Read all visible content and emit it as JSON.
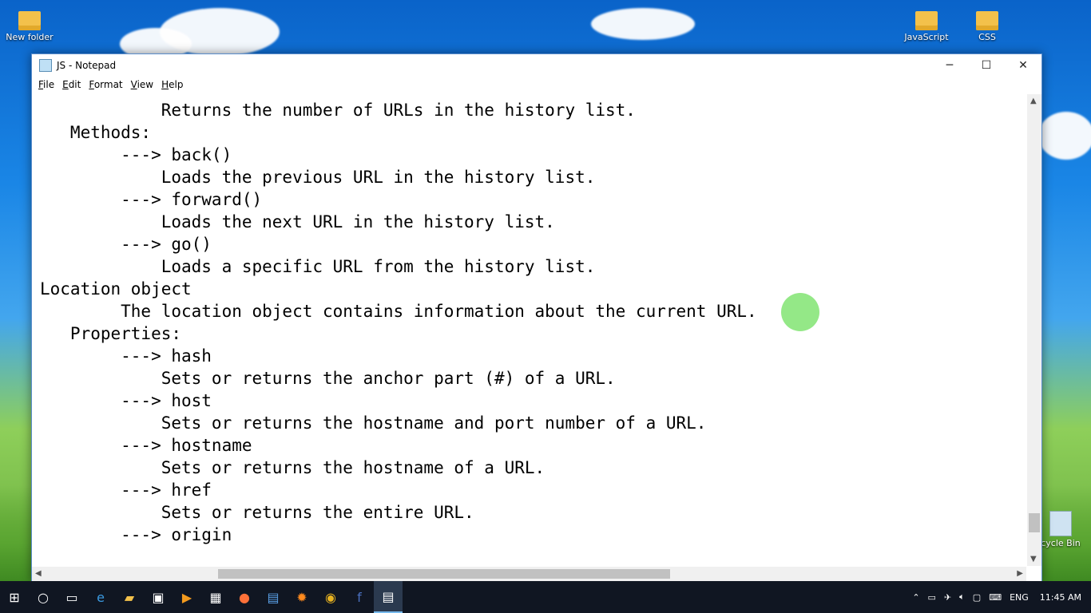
{
  "desktop": {
    "icons": [
      {
        "label": "New folder"
      },
      {
        "label": "JavaScript"
      },
      {
        "label": "CSS"
      },
      {
        "label": "cycle Bin"
      }
    ]
  },
  "window": {
    "title": "JS - Notepad",
    "controls": {
      "minimize": "─",
      "maximize": "☐",
      "close": "✕"
    },
    "menu": {
      "file": {
        "accel": "F",
        "rest": "ile"
      },
      "edit": {
        "accel": "E",
        "rest": "dit"
      },
      "format": {
        "accel": "F",
        "rest": "ormat"
      },
      "view": {
        "accel": "V",
        "rest": "iew"
      },
      "help": {
        "accel": "H",
        "rest": "elp"
      }
    },
    "lines": [
      "            Returns the number of URLs in the history list.",
      "   Methods:",
      "        ---> back()",
      "            Loads the previous URL in the history list.",
      "        ---> forward()",
      "            Loads the next URL in the history list.",
      "        ---> go()",
      "            Loads a specific URL from the history list.",
      "Location object",
      "        The location object contains information about the current URL.",
      "   Properties:",
      "        ---> hash",
      "            Sets or returns the anchor part (#) of a URL.",
      "        ---> host",
      "            Sets or returns the hostname and port number of a URL.",
      "        ---> hostname",
      "            Sets or returns the hostname of a URL.",
      "        ---> href",
      "            Sets or returns the entire URL.",
      "        ---> origin"
    ]
  },
  "taskbar": {
    "language": "ENG",
    "time": "11:45 AM"
  }
}
